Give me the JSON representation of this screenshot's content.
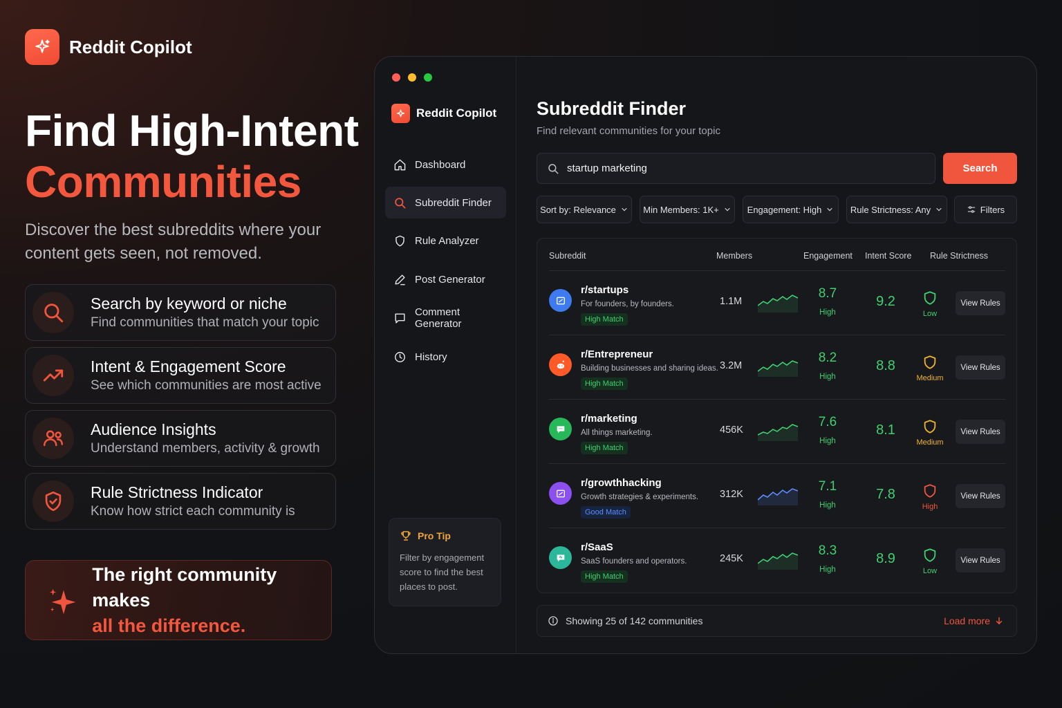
{
  "brand": {
    "name": "Reddit Copilot"
  },
  "hero": {
    "title_line1": "Find High-Intent",
    "title_line2": "Communities",
    "subtitle": "Discover the best subreddits where your content gets seen, not removed."
  },
  "features": [
    {
      "icon": "search-icon",
      "title": "Search by keyword or niche",
      "desc": "Find communities that match your topic"
    },
    {
      "icon": "trend-up-icon",
      "title": "Intent & Engagement Score",
      "desc": "See which communities are most active"
    },
    {
      "icon": "users-icon",
      "title": "Audience Insights",
      "desc": "Understand members, activity & growth"
    },
    {
      "icon": "shield-check-icon",
      "title": "Rule Strictness Indicator",
      "desc": "Know how strict each community is"
    }
  ],
  "banner": {
    "line1": "The right community makes",
    "line2": "all the difference."
  },
  "app": {
    "brand": "Reddit Copilot",
    "nav": [
      {
        "label": "Dashboard",
        "icon": "home-icon"
      },
      {
        "label": "Subreddit Finder",
        "icon": "search-icon",
        "active": true
      },
      {
        "label": "Rule Analyzer",
        "icon": "shield-icon"
      },
      {
        "label": "Post Generator",
        "icon": "pencil-icon"
      },
      {
        "label": "Comment Generator",
        "icon": "comment-icon"
      },
      {
        "label": "History",
        "icon": "clock-icon"
      }
    ],
    "protip": {
      "title": "Pro Tip",
      "body": "Filter by engagement score to find the best places to post."
    },
    "page": {
      "title": "Subreddit Finder",
      "subtitle": "Find relevant communities for your topic"
    },
    "search": {
      "value": "startup marketing",
      "button": "Search"
    },
    "filters": [
      "Sort by: Relevance",
      "Min Members: 1K+",
      "Engagement: High",
      "Rule Strictness: Any",
      "Filters"
    ],
    "table": {
      "headers": {
        "subreddit": "Subreddit",
        "members": "Members",
        "engagement": "Engagement",
        "intent": "Intent Score",
        "strictness": "Rule Strictness"
      },
      "rows": [
        {
          "name": "r/startups",
          "desc": "For founders, by founders.",
          "match": "High Match",
          "members": "1.1M",
          "engagement": "8.7",
          "engagement_level": "High",
          "intent": "9.2",
          "strictness": "Low",
          "action": "View Rules"
        },
        {
          "name": "r/Entrepreneur",
          "desc": "Building businesses and sharing ideas.",
          "match": "High Match",
          "members": "3.2M",
          "engagement": "8.2",
          "engagement_level": "High",
          "intent": "8.8",
          "strictness": "Medium",
          "action": "View Rules"
        },
        {
          "name": "r/marketing",
          "desc": "All things marketing.",
          "match": "High Match",
          "members": "456K",
          "engagement": "7.6",
          "engagement_level": "High",
          "intent": "8.1",
          "strictness": "Medium",
          "action": "View Rules"
        },
        {
          "name": "r/growthhacking",
          "desc": "Growth strategies & experiments.",
          "match": "Good Match",
          "members": "312K",
          "engagement": "7.1",
          "engagement_level": "High",
          "intent": "7.8",
          "strictness": "High",
          "action": "View Rules"
        },
        {
          "name": "r/SaaS",
          "desc": "SaaS founders and operators.",
          "match": "High Match",
          "members": "245K",
          "engagement": "8.3",
          "engagement_level": "High",
          "intent": "8.9",
          "strictness": "Low",
          "action": "View Rules"
        }
      ]
    },
    "footer": {
      "showing": "Showing 25 of 142 communities",
      "load_more": "Load more"
    }
  },
  "colors": {
    "accent": "#f0553d",
    "green": "#3fd070",
    "amber": "#f0b429",
    "red": "#f0553d",
    "blue": "#5c8cff"
  }
}
